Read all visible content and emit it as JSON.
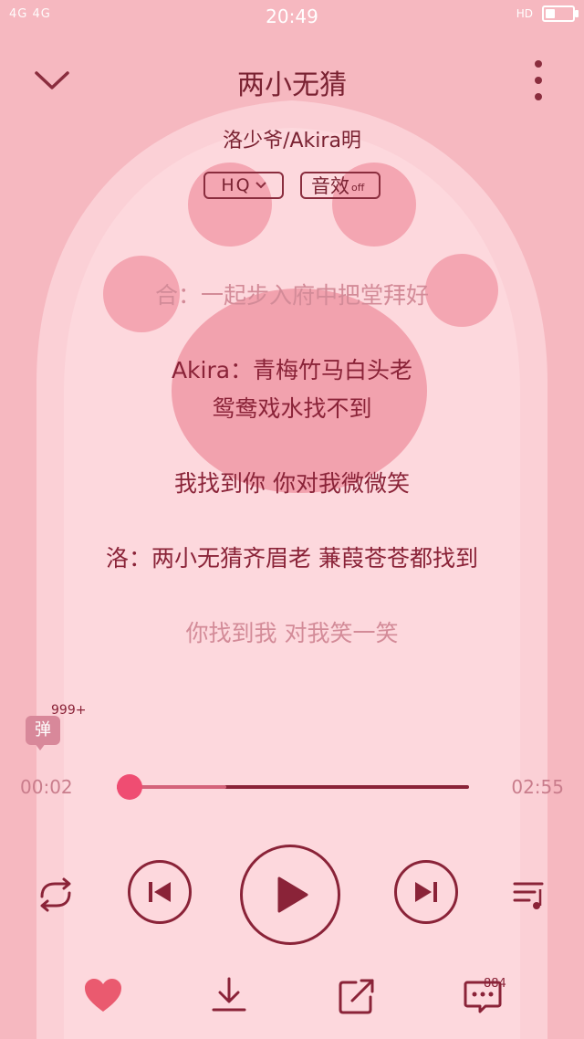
{
  "status": {
    "net": "4G 4G",
    "time": "20:49",
    "hd": "HD",
    "battery_level": 0.35
  },
  "header": {
    "title": "两小无猜"
  },
  "artist": "洛少爷/Akira明",
  "chips": {
    "quality": "HQ",
    "effect": "音效",
    "effect_state": "off"
  },
  "lyrics": [
    {
      "text": "合：一起步入府中把堂拜好",
      "state": "past"
    },
    {
      "text": "Akira：青梅竹马白头老",
      "state": "active"
    },
    {
      "text": "鸳鸯戏水找不到",
      "state": "active"
    },
    {
      "text": "我找到你 你对我微微笑",
      "state": "active"
    },
    {
      "text": "洛：两小无猜齐眉老 蒹葭苍苍都找到",
      "state": "active"
    },
    {
      "text": "你找到我 对我笑一笑",
      "state": "upcoming"
    }
  ],
  "danmu": {
    "label": "弹",
    "count": "999+"
  },
  "progress": {
    "current": "00:02",
    "total": "02:55",
    "played_fraction": 0.01,
    "buffered_fraction": 0.31
  },
  "comments": {
    "count": "884"
  },
  "colors": {
    "accent": "#8a2338",
    "knob": "#ef4d72",
    "background": "#f6b8c0",
    "heart": "#ea5a6f"
  },
  "icons": [
    "chevron-down-icon",
    "more-vertical-icon",
    "repeat-icon",
    "previous-icon",
    "play-icon",
    "next-icon",
    "playlist-icon",
    "heart-icon",
    "download-icon",
    "share-icon",
    "comment-icon"
  ]
}
